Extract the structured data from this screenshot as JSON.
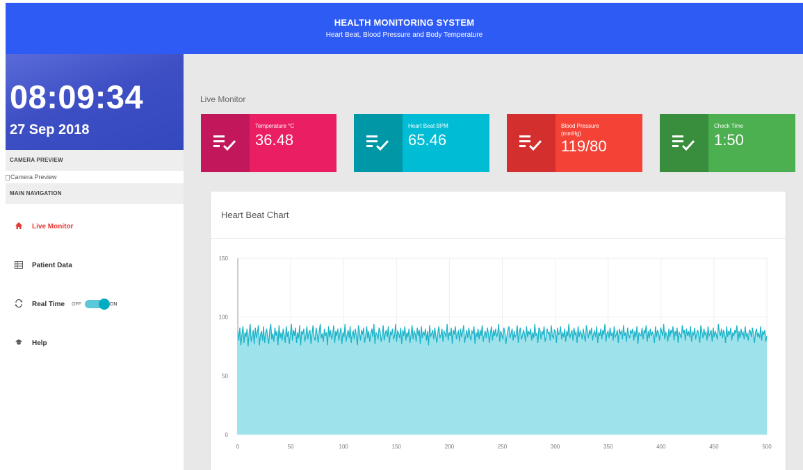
{
  "header": {
    "title": "HEALTH MONITORING SYSTEM",
    "subtitle": "Heart Beat, Blood Pressure and Body Temperature"
  },
  "sidebar": {
    "time": "08:09:34",
    "date": "27 Sep 2018",
    "camera_heading": "CAMERA PREVIEW",
    "camera_alt": "Camera Preview",
    "nav_heading": "MAIN NAVIGATION",
    "nav": [
      {
        "label": "Live Monitor",
        "icon": "home-icon",
        "active": true
      },
      {
        "label": "Patient Data",
        "icon": "table-icon",
        "active": false
      },
      {
        "label": "Real Time",
        "icon": "realtime-icon",
        "active": false
      },
      {
        "label": "Help",
        "icon": "help-icon",
        "active": false
      }
    ],
    "toggle": {
      "off_label": "OFF",
      "on_label": "ON",
      "state": "on"
    }
  },
  "main": {
    "section_title": "Live Monitor",
    "cards": [
      {
        "label": "Temperature °C",
        "value": "36.48",
        "color": "#e91e63",
        "icon_bg": "#c2185b",
        "icon": "checklist-icon"
      },
      {
        "label": "Heart Beat BPM",
        "value": "65.46",
        "color": "#00bcd4",
        "icon_bg": "#0097a7",
        "icon": "checklist-icon"
      },
      {
        "label": "Blood Pressure (mmHg)",
        "value": "119/80",
        "color": "#f44336",
        "icon_bg": "#d32f2f",
        "icon": "checklist-icon"
      },
      {
        "label": "Check Time",
        "value": "1:50",
        "color": "#4caf50",
        "icon_bg": "#388e3c",
        "icon": "checklist-icon"
      }
    ],
    "chart_title": "Heart Beat Chart"
  },
  "colors": {
    "header": "#2f5bf5",
    "active_nav": "#e53935",
    "chart_fill": "#9ee3ec",
    "chart_line": "#1cb3c8"
  },
  "chart_data": {
    "type": "area",
    "title": "Heart Beat Chart",
    "xlabel": "",
    "ylabel": "",
    "xlim": [
      0,
      500
    ],
    "ylim": [
      0,
      150
    ],
    "x_ticks": [
      "0",
      "50",
      "100",
      "150",
      "200",
      "250",
      "300",
      "350",
      "400",
      "450",
      "500"
    ],
    "y_ticks": [
      "0",
      "50",
      "100",
      "150"
    ],
    "grid": true,
    "series": [
      {
        "values": [
          88,
          80,
          91,
          76,
          85,
          92,
          78,
          87,
          83,
          90,
          75,
          86,
          94,
          79,
          84,
          89,
          77,
          91,
          82,
          87,
          93,
          76,
          85,
          88,
          80,
          92,
          78,
          86,
          90,
          83,
          77,
          89,
          94,
          81,
          86,
          79,
          91,
          84,
          88,
          76,
          93,
          82,
          87,
          80,
          90,
          85,
          78,
          92,
          83,
          88,
          77,
          86,
          94,
          80,
          89,
          84,
          91,
          78,
          87,
          82,
          93,
          76,
          88,
          85,
          90,
          79,
          84,
          92,
          81,
          87,
          89,
          77,
          86,
          93,
          83,
          80,
          91,
          85,
          78,
          88,
          94,
          82,
          86,
          79,
          90,
          84,
          87,
          76,
          92,
          83,
          89,
          81,
          85,
          93,
          78,
          88,
          84,
          90,
          80,
          86,
          91,
          77,
          87,
          83,
          94,
          79,
          85,
          89,
          82,
          92,
          78,
          86,
          88,
          81,
          90,
          84,
          76,
          93,
          87,
          80,
          89,
          85,
          91,
          78,
          84,
          92,
          82,
          88,
          79,
          86,
          90,
          83,
          94,
          77,
          87,
          85,
          81,
          91,
          88,
          79,
          84,
          93,
          80,
          86,
          89,
          83,
          92,
          78,
          87,
          85,
          90,
          81,
          84,
          94,
          79,
          88,
          86,
          82,
          91,
          77,
          89,
          84,
          92,
          80,
          87,
          83,
          90,
          78,
          85,
          93,
          81,
          88,
          86,
          79,
          91,
          84,
          89,
          77,
          92,
          82,
          87,
          85,
          90,
          80,
          88,
          76,
          93,
          83,
          86,
          89,
          81,
          91,
          84,
          78,
          87,
          92,
          82,
          85,
          90,
          79,
          88,
          86,
          83,
          94,
          80,
          87,
          84,
          91,
          77,
          89,
          85,
          92,
          81,
          86,
          88,
          79,
          90,
          83,
          87,
          93,
          78,
          84,
          89,
          82,
          91,
          85,
          80,
          88,
          86,
          92,
          77,
          87,
          83,
          90,
          81,
          89,
          84,
          93,
          79,
          85,
          88,
          82,
          91,
          86,
          78,
          87,
          92,
          80,
          89,
          84,
          90,
          83,
          86,
          94,
          79,
          88,
          85,
          81,
          91,
          87,
          77,
          84,
          89,
          92,
          82,
          86,
          90,
          80,
          88,
          83,
          85,
          93,
          78,
          87,
          91,
          81,
          84,
          89,
          86,
          79,
          92,
          83,
          88,
          85,
          90,
          80,
          87,
          82,
          94,
          84,
          86,
          78,
          91,
          89,
          81,
          88,
          85,
          92,
          79,
          83,
          90,
          86,
          87,
          80,
          93,
          84,
          82,
          89,
          88,
          78,
          91,
          85,
          86,
          92,
          81,
          87,
          83,
          90,
          79,
          88,
          84,
          94,
          82,
          86,
          89,
          80,
          91,
          85,
          87,
          78,
          92,
          83,
          88,
          86,
          81,
          90,
          84,
          79,
          93,
          87,
          82,
          89,
          85,
          91,
          80,
          86,
          88,
          83,
          92,
          78,
          87,
          84,
          90,
          81,
          89,
          85,
          94,
          79,
          86,
          88,
          82,
          91,
          84,
          87,
          80,
          92,
          83,
          85,
          89,
          78,
          90,
          86,
          88,
          81,
          93,
          84,
          87,
          79,
          91,
          85,
          82,
          89,
          86,
          90,
          80,
          88,
          83,
          92,
          77,
          87,
          85,
          84,
          91,
          81,
          89,
          86,
          93,
          79,
          88,
          82,
          90,
          84,
          87,
          85,
          78,
          92,
          83,
          89,
          86,
          80,
          91,
          88,
          84,
          94,
          81,
          87,
          85,
          79,
          90,
          83,
          89,
          86,
          92,
          80,
          88,
          84,
          91,
          78,
          87,
          85,
          82,
          93,
          86,
          89,
          80,
          90,
          84,
          88,
          83,
          92,
          79,
          87,
          85,
          91,
          81,
          86,
          89,
          84,
          78,
          93,
          88,
          82,
          90,
          85,
          87,
          80,
          92,
          84,
          86,
          89,
          79,
          91,
          83,
          88,
          85,
          81,
          94,
          87,
          84,
          90,
          82,
          89,
          86,
          78,
          92,
          83,
          88,
          85,
          91,
          80,
          87,
          84,
          89,
          86,
          93,
          79,
          88,
          82,
          90,
          85,
          87,
          81,
          92,
          84,
          86,
          80,
          89,
          88,
          83,
          91,
          85,
          78,
          87,
          90,
          84,
          86,
          82,
          92,
          80,
          88,
          85,
          89,
          79,
          84
        ]
      }
    ]
  }
}
